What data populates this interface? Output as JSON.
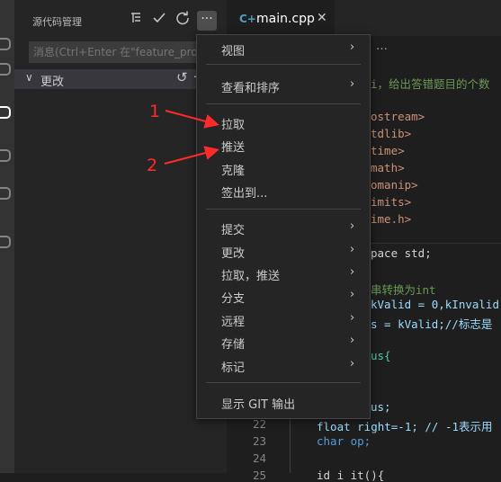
{
  "scm": {
    "title": "源代码管理",
    "toolbar": {
      "view_as_tree_icon": "list-tree-icon",
      "commit_icon": "check-icon",
      "refresh_icon": "refresh-icon",
      "more_label": "···"
    },
    "commit_placeholder": "消息(Ctrl+Enter 在\"feature_proj",
    "changes_label": "更改",
    "changes_chevron": "∨",
    "undo_glyph": "↺",
    "add_glyph": "+"
  },
  "editor": {
    "tab": {
      "icon_glyph": "C+",
      "label": "main.cpp",
      "close_glyph": "✕"
    },
    "breadcrumb_tail": "…",
    "line_numbers": [
      "22",
      "23",
      "24",
      "25"
    ],
    "code_fragments": [
      "i，给出答错题目的个数",
      "ostream>",
      "tdlib>",
      "time>",
      "math>",
      "omanip>",
      "imits>",
      "ime.h>",
      "pace std;",
      "串转换为int",
      "kValid = 0,kInvalid",
      "s = kValid;//标志是",
      "us{",
      "us;",
      "float right=-1; // -1表示用",
      "char op;",
      "id i it(){"
    ]
  },
  "menu": {
    "items": [
      {
        "label": "视图",
        "submenu": true
      },
      {
        "label": "查看和排序",
        "submenu": true
      },
      {
        "label": "拉取",
        "submenu": false
      },
      {
        "label": "推送",
        "submenu": false
      },
      {
        "label": "克隆",
        "submenu": false
      },
      {
        "label": "签出到...",
        "submenu": false
      },
      {
        "label": "提交",
        "submenu": true
      },
      {
        "label": "更改",
        "submenu": true
      },
      {
        "label": "拉取，推送",
        "submenu": true
      },
      {
        "label": "分支",
        "submenu": true
      },
      {
        "label": "远程",
        "submenu": true
      },
      {
        "label": "存储",
        "submenu": true
      },
      {
        "label": "标记",
        "submenu": true
      },
      {
        "label": "显示 GIT 输出",
        "submenu": false
      }
    ],
    "arrow_glyph": "›"
  },
  "annotations": {
    "first": "1",
    "second": "2",
    "color": "#ff2a2a"
  },
  "colors": {
    "sidebar_bg": "#252526",
    "editor_bg": "#1e1e1e",
    "menu_bg": "#252526",
    "accent": "#519aba"
  }
}
